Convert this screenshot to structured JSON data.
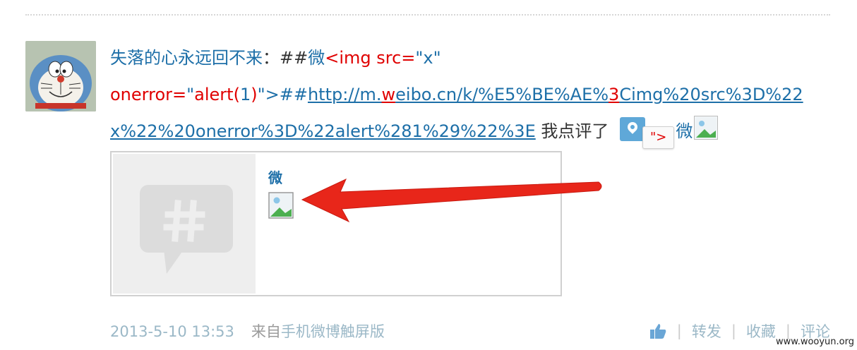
{
  "post": {
    "author": "失落的心永远回不来",
    "colon": "：",
    "line1_hash": "##",
    "line1_wei": "微",
    "line1_payload_red": "<img src=",
    "line1_payload_quote": "\"x\"",
    "line2_onerror": "onerror=",
    "line2_quote1": "\"",
    "line2_alert": "alert(",
    "line2_num": "1",
    "line2_close": ")",
    "line2_tail": "\">##",
    "link_part1": "http://m.",
    "link_w": "w",
    "link_part2": "eibo.cn/k/%E5%BE%AE%",
    "link_3": "3",
    "link_part3": "Cimg%20src%3D%22",
    "link_line3": "x%22%20onerror%3D%22alert%281%29%22%3E",
    "comment_text": " 我点评了 ",
    "chip_text": "\">",
    "wei_after_chip": "微"
  },
  "card": {
    "title": "微"
  },
  "footer": {
    "timestamp": "2013-5-10 13:53",
    "from_label": "来自",
    "client": "手机微博触屏版"
  },
  "actions": {
    "repost": "转发",
    "favorite": "收藏",
    "comment": "评论",
    "separator": "|"
  },
  "watermark": "www.wooyun.org",
  "colors": {
    "link_blue": "#1d6fa8",
    "payload_red": "#e00000",
    "arrow_red": "#e8261a"
  }
}
